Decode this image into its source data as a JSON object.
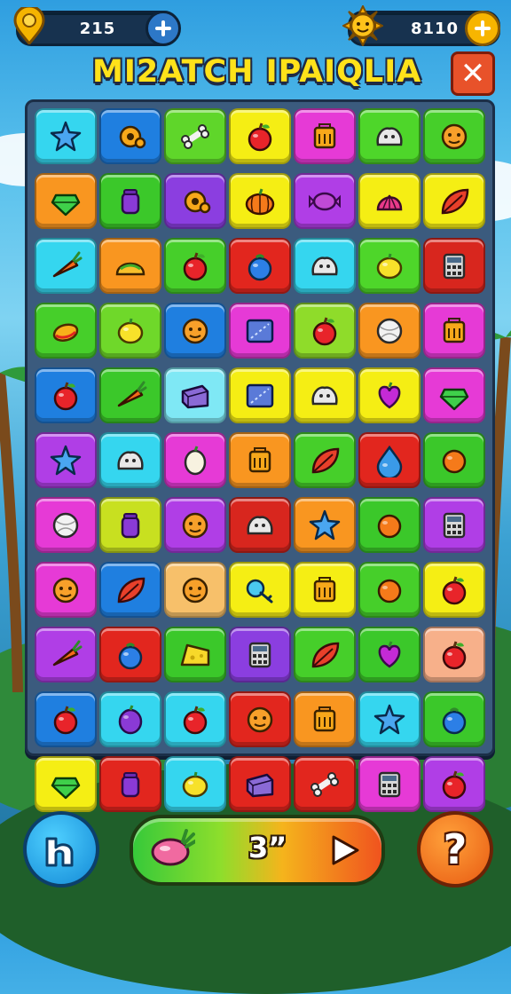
{
  "header": {
    "left_counter": "215",
    "right_counter": "8110",
    "title": "MI2ATCH IPAIQLIA",
    "close_symbol": "✕"
  },
  "board": {
    "rows": 11,
    "cols": 7,
    "tiles": [
      [
        {
          "bg": "#35d6ef",
          "icon": "star-icon"
        },
        {
          "bg": "#1f7fe0",
          "icon": "gear-icon"
        },
        {
          "bg": "#5fd62a",
          "icon": "bone-icon"
        },
        {
          "bg": "#f5ee14",
          "icon": "apple-icon"
        },
        {
          "bg": "#e63ad6",
          "icon": "box-icon"
        },
        {
          "bg": "#4ed62a",
          "icon": "blob-icon"
        },
        {
          "bg": "#46cf2a",
          "icon": "face-icon"
        }
      ],
      [
        {
          "bg": "#f99620",
          "icon": "gem-icon"
        },
        {
          "bg": "#3bc82a",
          "icon": "jar-icon"
        },
        {
          "bg": "#8b3ee0",
          "icon": "gear-icon"
        },
        {
          "bg": "#f5ee14",
          "icon": "pumpkin-icon"
        },
        {
          "bg": "#b03ee6",
          "icon": "candy-icon"
        },
        {
          "bg": "#f5ee14",
          "icon": "shell-icon"
        },
        {
          "bg": "#f5ee14",
          "icon": "leaf-icon"
        }
      ],
      [
        {
          "bg": "#35d6ef",
          "icon": "carrot-icon"
        },
        {
          "bg": "#f99620",
          "icon": "taco-icon"
        },
        {
          "bg": "#46cf2a",
          "icon": "apple-icon"
        },
        {
          "bg": "#e2261e",
          "icon": "berry-icon"
        },
        {
          "bg": "#35d6ef",
          "icon": "blob-icon"
        },
        {
          "bg": "#4ed62a",
          "icon": "lemon-icon"
        },
        {
          "bg": "#d8261e",
          "icon": "calc-icon"
        }
      ],
      [
        {
          "bg": "#46cf2a",
          "icon": "mango-icon"
        },
        {
          "bg": "#6fd82a",
          "icon": "lemon-icon"
        },
        {
          "bg": "#1f7fe0",
          "icon": "face-icon"
        },
        {
          "bg": "#e63ad6",
          "icon": "screen-icon"
        },
        {
          "bg": "#8fdc2a",
          "icon": "apple-icon"
        },
        {
          "bg": "#f99620",
          "icon": "ball-icon"
        },
        {
          "bg": "#e63ad6",
          "icon": "box-icon"
        }
      ],
      [
        {
          "bg": "#1f7fe0",
          "icon": "apple-icon"
        },
        {
          "bg": "#3bc82a",
          "icon": "carrot-icon"
        },
        {
          "bg": "#7fe8f5",
          "icon": "block-icon"
        },
        {
          "bg": "#f5ee14",
          "icon": "screen-icon"
        },
        {
          "bg": "#f5ee14",
          "icon": "blob-icon"
        },
        {
          "bg": "#f5ee14",
          "icon": "heart-icon"
        },
        {
          "bg": "#e63ad6",
          "icon": "gem-icon"
        }
      ],
      [
        {
          "bg": "#b03ee6",
          "icon": "star-icon"
        },
        {
          "bg": "#35d6ef",
          "icon": "blob-icon"
        },
        {
          "bg": "#e63ad6",
          "icon": "egg-icon"
        },
        {
          "bg": "#f99620",
          "icon": "box-icon"
        },
        {
          "bg": "#46cf2a",
          "icon": "leaf-icon"
        },
        {
          "bg": "#e2261e",
          "icon": "drop-icon"
        },
        {
          "bg": "#3bc82a",
          "icon": "orange-icon"
        }
      ],
      [
        {
          "bg": "#e63ad6",
          "icon": "ball-icon"
        },
        {
          "bg": "#c8e020",
          "icon": "jar-icon"
        },
        {
          "bg": "#b03ee6",
          "icon": "face-icon"
        },
        {
          "bg": "#d8261e",
          "icon": "blob-icon"
        },
        {
          "bg": "#f99620",
          "icon": "star-icon"
        },
        {
          "bg": "#3bc82a",
          "icon": "orange-icon"
        },
        {
          "bg": "#b03ee6",
          "icon": "calc-icon"
        }
      ],
      [
        {
          "bg": "#e63ad6",
          "icon": "face-icon"
        },
        {
          "bg": "#1f7fe0",
          "icon": "leaf-icon"
        },
        {
          "bg": "#f7c06a",
          "icon": "face-icon"
        },
        {
          "bg": "#f5ee14",
          "icon": "key-icon"
        },
        {
          "bg": "#f5ee14",
          "icon": "box-icon"
        },
        {
          "bg": "#46cf2a",
          "icon": "orange-icon"
        },
        {
          "bg": "#f5ee14",
          "icon": "apple-icon"
        }
      ],
      [
        {
          "bg": "#b03ee6",
          "icon": "carrot-icon"
        },
        {
          "bg": "#e2261e",
          "icon": "berry-icon"
        },
        {
          "bg": "#3bc82a",
          "icon": "cheese-icon"
        },
        {
          "bg": "#8b3ee0",
          "icon": "calc-icon"
        },
        {
          "bg": "#46cf2a",
          "icon": "leaf-icon"
        },
        {
          "bg": "#3bc82a",
          "icon": "heart-icon"
        },
        {
          "bg": "#f7b08a",
          "icon": "apple-icon"
        }
      ],
      [
        {
          "bg": "#1f7fe0",
          "icon": "apple-icon"
        },
        {
          "bg": "#35d6ef",
          "icon": "grape-icon"
        },
        {
          "bg": "#35d6ef",
          "icon": "apple-icon"
        },
        {
          "bg": "#e2261e",
          "icon": "face-icon"
        },
        {
          "bg": "#f99620",
          "icon": "box-icon"
        },
        {
          "bg": "#35d6ef",
          "icon": "star-icon"
        },
        {
          "bg": "#3bc82a",
          "icon": "berry-icon"
        }
      ],
      [
        {
          "bg": "#f5ee14",
          "icon": "gem-icon"
        },
        {
          "bg": "#e2261e",
          "icon": "jar-icon"
        },
        {
          "bg": "#35d6ef",
          "icon": "lemon-icon"
        },
        {
          "bg": "#e2261e",
          "icon": "block-icon"
        },
        {
          "bg": "#e2261e",
          "icon": "bone-icon"
        },
        {
          "bg": "#e63ad6",
          "icon": "calc-icon"
        },
        {
          "bg": "#b03ee6",
          "icon": "apple-icon"
        }
      ]
    ]
  },
  "footer": {
    "timer": "3”",
    "play_icon": "play-icon",
    "help_symbol": "?"
  }
}
